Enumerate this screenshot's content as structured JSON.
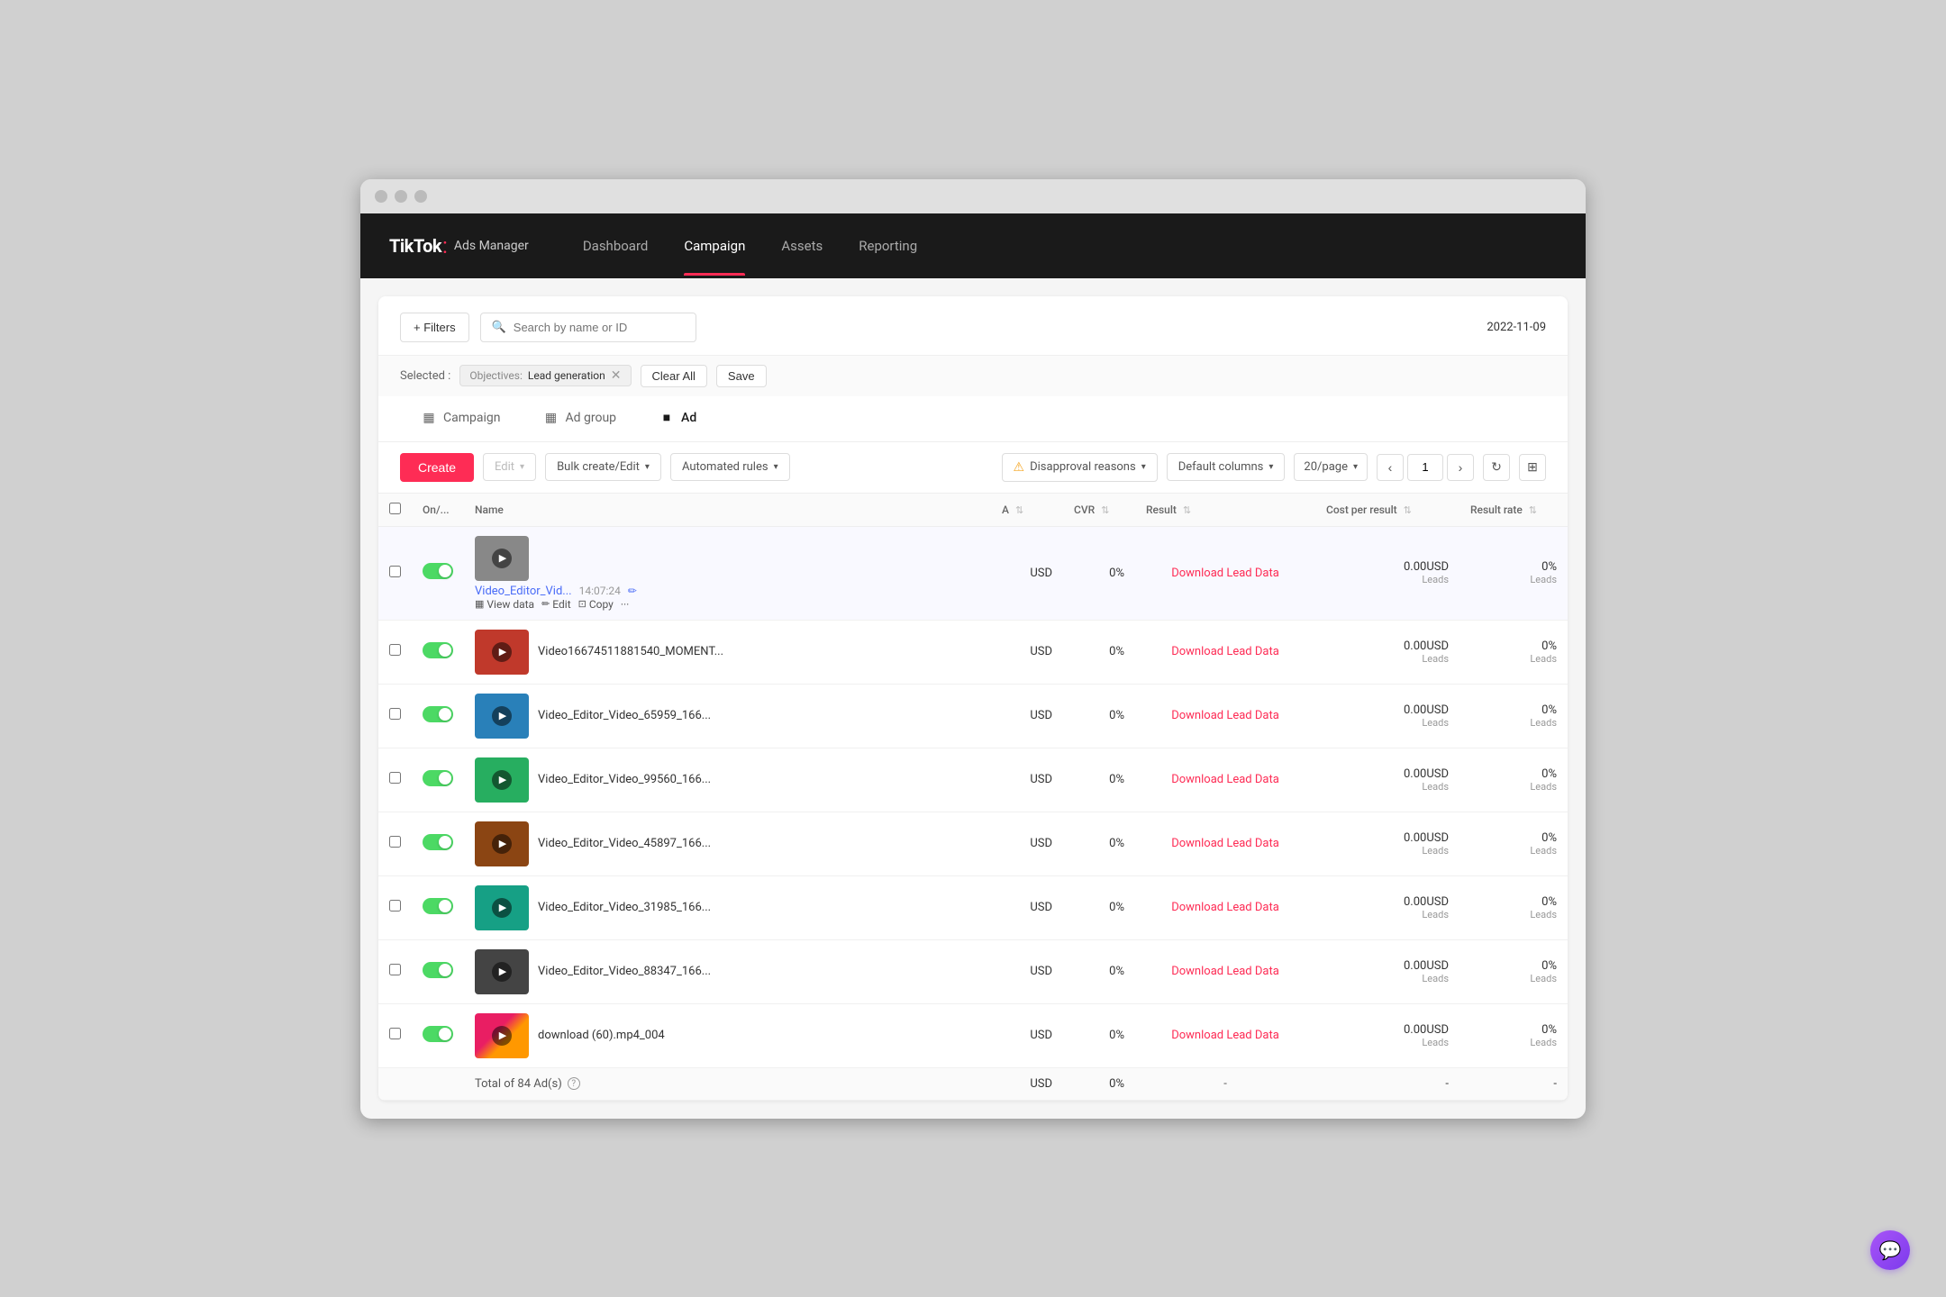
{
  "browser": {
    "dots": [
      "dot1",
      "dot2",
      "dot3"
    ]
  },
  "nav": {
    "logo": "TikTok",
    "colon": ":",
    "sub": "Ads Manager",
    "items": [
      {
        "label": "Dashboard",
        "active": false
      },
      {
        "label": "Campaign",
        "active": true
      },
      {
        "label": "Assets",
        "active": false
      },
      {
        "label": "Reporting",
        "active": false
      }
    ]
  },
  "filter_bar": {
    "filters_btn": "+ Filters",
    "search_placeholder": "Search by name or ID",
    "date": "2022-11-09"
  },
  "selected_bar": {
    "label": "Selected :",
    "filter_label": "Objectives:",
    "filter_value": "Lead generation",
    "clear_all": "Clear All",
    "save": "Save"
  },
  "tabs": [
    {
      "label": "Campaign",
      "active": false,
      "icon": "grid"
    },
    {
      "label": "Ad group",
      "active": false,
      "icon": "grid"
    },
    {
      "label": "Ad",
      "active": true,
      "icon": "square"
    }
  ],
  "toolbar": {
    "create": "Create",
    "edit": "Edit",
    "bulk_create": "Bulk create/Edit",
    "automated_rules": "Automated rules",
    "disapproval": "Disapproval reasons",
    "default_columns": "Default columns",
    "page_size": "20/page",
    "page_current": "1",
    "refresh": "↻",
    "export": "⊞"
  },
  "table": {
    "headers": [
      {
        "key": "select",
        "label": ""
      },
      {
        "key": "toggle",
        "label": "On/..."
      },
      {
        "key": "name",
        "label": "Name"
      },
      {
        "key": "a",
        "label": "A"
      },
      {
        "key": "cvr",
        "label": "CVR"
      },
      {
        "key": "result",
        "label": "Result"
      },
      {
        "key": "cost",
        "label": "Cost per result"
      },
      {
        "key": "rate",
        "label": "Result rate"
      }
    ],
    "rows": [
      {
        "id": 1,
        "active": true,
        "thumb_color": "thumb-gray",
        "name": "Video_Editor_Vid...",
        "time": "14:07:24",
        "has_actions": true,
        "view_data": "View data",
        "edit": "Edit",
        "copy": "Copy",
        "a_val": "USD",
        "cvr": "0%",
        "result": "Download Lead Data",
        "cost": "0.00USD",
        "cost_sub": "Leads",
        "rate": "0%",
        "rate_sub": "Leads",
        "highlighted": true
      },
      {
        "id": 2,
        "active": true,
        "thumb_color": "thumb-red",
        "name": "Video16674511881540_MOMENT...",
        "has_actions": false,
        "a_val": "USD",
        "cvr": "0%",
        "result": "Download Lead Data",
        "cost": "0.00USD",
        "cost_sub": "Leads",
        "rate": "0%",
        "rate_sub": "Leads"
      },
      {
        "id": 3,
        "active": true,
        "thumb_color": "thumb-blue",
        "name": "Video_Editor_Video_65959_166...",
        "has_actions": false,
        "a_val": "USD",
        "cvr": "0%",
        "result": "Download Lead Data",
        "cost": "0.00USD",
        "cost_sub": "Leads",
        "rate": "0%",
        "rate_sub": "Leads"
      },
      {
        "id": 4,
        "active": true,
        "thumb_color": "thumb-green",
        "name": "Video_Editor_Video_99560_166...",
        "has_actions": false,
        "a_val": "USD",
        "cvr": "0%",
        "result": "Download Lead Data",
        "cost": "0.00USD",
        "cost_sub": "Leads",
        "rate": "0%",
        "rate_sub": "Leads"
      },
      {
        "id": 5,
        "active": true,
        "thumb_color": "thumb-brown",
        "name": "Video_Editor_Video_45897_166...",
        "has_actions": false,
        "a_val": "USD",
        "cvr": "0%",
        "result": "Download Lead Data",
        "cost": "0.00USD",
        "cost_sub": "Leads",
        "rate": "0%",
        "rate_sub": "Leads"
      },
      {
        "id": 6,
        "active": true,
        "thumb_color": "thumb-teal",
        "name": "Video_Editor_Video_31985_166...",
        "has_actions": false,
        "a_val": "USD",
        "cvr": "0%",
        "result": "Download Lead Data",
        "cost": "0.00USD",
        "cost_sub": "Leads",
        "rate": "0%",
        "rate_sub": "Leads"
      },
      {
        "id": 7,
        "active": true,
        "thumb_color": "thumb-dark",
        "name": "Video_Editor_Video_88347_166...",
        "has_actions": false,
        "a_val": "USD",
        "cvr": "0%",
        "result": "Download Lead Data",
        "cost": "0.00USD",
        "cost_sub": "Leads",
        "rate": "0%",
        "rate_sub": "Leads"
      },
      {
        "id": 8,
        "active": true,
        "thumb_color": "thumb-pink",
        "name": "download (60).mp4_004",
        "has_actions": false,
        "a_val": "USD",
        "cvr": "0%",
        "result": "Download Lead Data",
        "cost": "0.00USD",
        "cost_sub": "Leads",
        "rate": "0%",
        "rate_sub": "Leads"
      }
    ],
    "total": {
      "label": "Total of 84 Ad(s)",
      "a_val": "USD",
      "cvr": "0%",
      "result": "-",
      "cost": "-",
      "rate": "-"
    }
  }
}
